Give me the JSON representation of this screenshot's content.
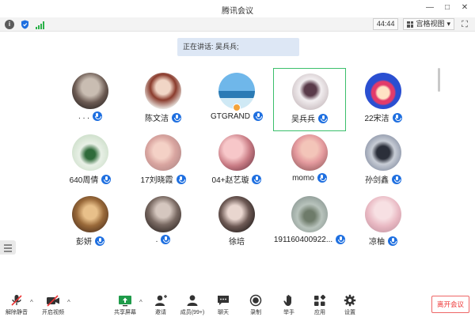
{
  "window": {
    "title": "腾讯会议",
    "controls": [
      "—",
      "□",
      "✕"
    ]
  },
  "status": {
    "timer": "44:44",
    "view_label": "宫格视图",
    "view_caret": "▾",
    "fullscreen_glyph": "⛶"
  },
  "speaker": {
    "text": "正在讲话: 吴兵兵;"
  },
  "participants": [
    {
      "name": ". . .",
      "mic": true
    },
    {
      "name": "陈文洁",
      "mic": true
    },
    {
      "name": "GTGRAND",
      "mic": true,
      "host": true
    },
    {
      "name": "吴兵兵",
      "mic": true,
      "active": true
    },
    {
      "name": "22宋洁",
      "mic": true
    },
    {
      "name": "640周倩",
      "mic": true
    },
    {
      "name": "17刘晓霞",
      "mic": true
    },
    {
      "name": "04+赵艺璇",
      "mic": true
    },
    {
      "name": "momo",
      "mic": true
    },
    {
      "name": "孙剑鑫",
      "mic": true
    },
    {
      "name": "彭妍",
      "mic": true
    },
    {
      "name": ".",
      "mic": true
    },
    {
      "name": "徐培",
      "mic": false
    },
    {
      "name": "191160400922...",
      "mic": true
    },
    {
      "name": "凉柚",
      "mic": true
    }
  ],
  "toolbar": {
    "unmute": "解除静音",
    "video": "开启视频",
    "share": "共享屏幕",
    "invite": "邀请",
    "members": "成员(99+)",
    "chat": "聊天",
    "record": "录制",
    "raise": "举手",
    "apps": "应用",
    "settings": "设置",
    "leave": "离开会议",
    "caret": "^"
  },
  "colors": {
    "accent": "#1e6fe0",
    "active_border": "#3bbf6b",
    "danger": "#e33333",
    "speaker_bg": "#dde7f5"
  }
}
